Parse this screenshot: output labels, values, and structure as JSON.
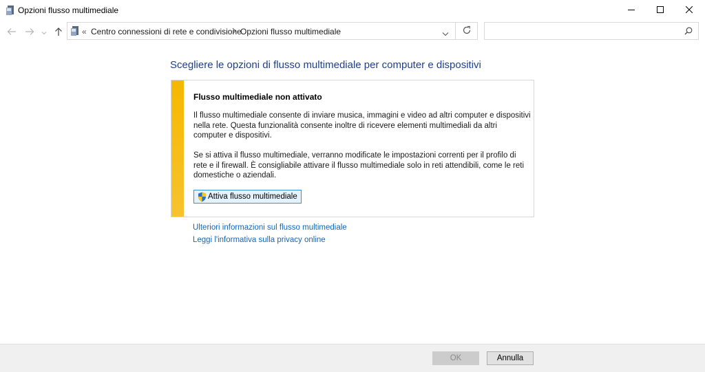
{
  "window": {
    "title": "Opzioni flusso multimediale",
    "controls": {
      "minimize": "minimize-icon",
      "maximize": "maximize-icon",
      "close": "close-icon"
    }
  },
  "nav": {
    "breadcrumb_overflow": "«",
    "breadcrumbs": [
      "Centro connessioni di rete e condivisione",
      "Opzioni flusso multimediale"
    ],
    "search_placeholder": ""
  },
  "main": {
    "heading": "Scegliere le opzioni di flusso multimediale per computer e dispositivi",
    "panel": {
      "title": "Flusso multimediale non attivato",
      "paragraph1": "Il flusso multimediale consente di inviare musica, immagini e video ad altri computer e dispositivi nella rete. Questa funzionalità consente inoltre di ricevere elementi multimediali da altri computer e dispositivi.",
      "paragraph2": "Se si attiva il flusso multimediale, verranno modificate le impostazioni correnti per il profilo di rete e il firewall. È consigliabile attivare il flusso multimediale solo in reti attendibili, come le reti domestiche o aziendali.",
      "button": "Attiva flusso multimediale",
      "accent": "#f5b800"
    },
    "links": [
      "Ulteriori informazioni sul flusso multimediale",
      "Leggi l'informativa sulla privacy online"
    ]
  },
  "footer": {
    "ok": "OK",
    "cancel": "Annulla"
  }
}
